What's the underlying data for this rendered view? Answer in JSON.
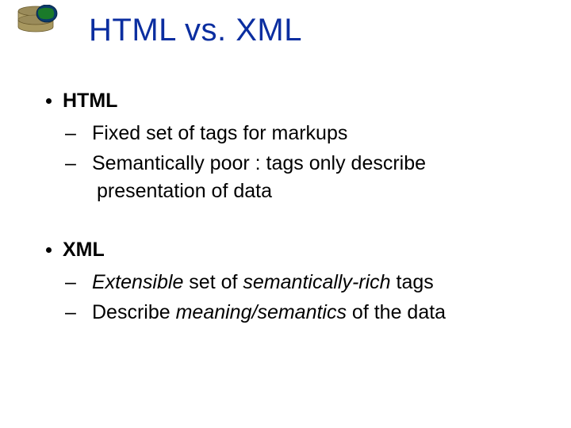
{
  "title": "HTML  vs.  XML",
  "sections": [
    {
      "heading": "HTML",
      "items": [
        {
          "dash": "–",
          "t0": "Fixed set of tags for markups"
        },
        {
          "dash": "–",
          "t0": "Semantically poor :  tags only describe presentation of data"
        }
      ]
    },
    {
      "heading": "XML",
      "items": [
        {
          "dash": "–",
          "i0": "Extensible",
          "t1": " set of ",
          "i2": "semantically-rich",
          "t3": " tags"
        },
        {
          "dash": "–",
          "t0": "Describe ",
          "i1": "meaning/semantics",
          "t2": " of the data"
        }
      ]
    }
  ]
}
